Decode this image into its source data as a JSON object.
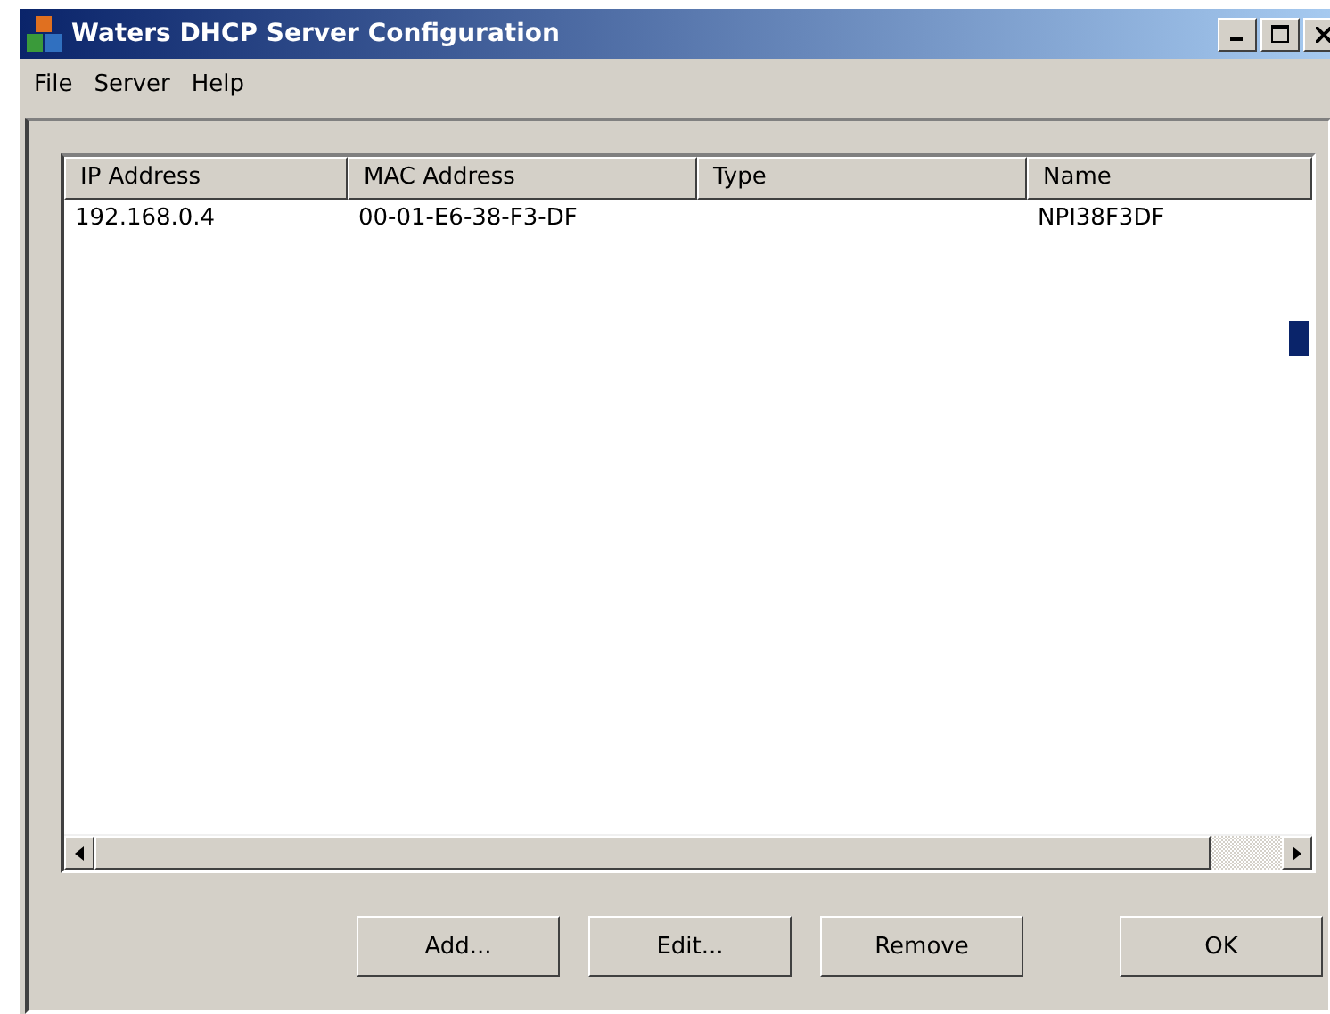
{
  "window": {
    "title": "Waters DHCP Server Configuration"
  },
  "menu": [
    "File",
    "Server",
    "Help"
  ],
  "table": {
    "columns": [
      "IP Address",
      "MAC Address",
      "Type",
      "Name"
    ],
    "rows": [
      {
        "cells": [
          "192.168.0.4",
          "00-01-E6-38-F3-DF",
          "",
          "NPI38F3DF"
        ]
      }
    ]
  },
  "buttons": [
    "Add...",
    "Edit...",
    "Remove",
    "OK"
  ]
}
